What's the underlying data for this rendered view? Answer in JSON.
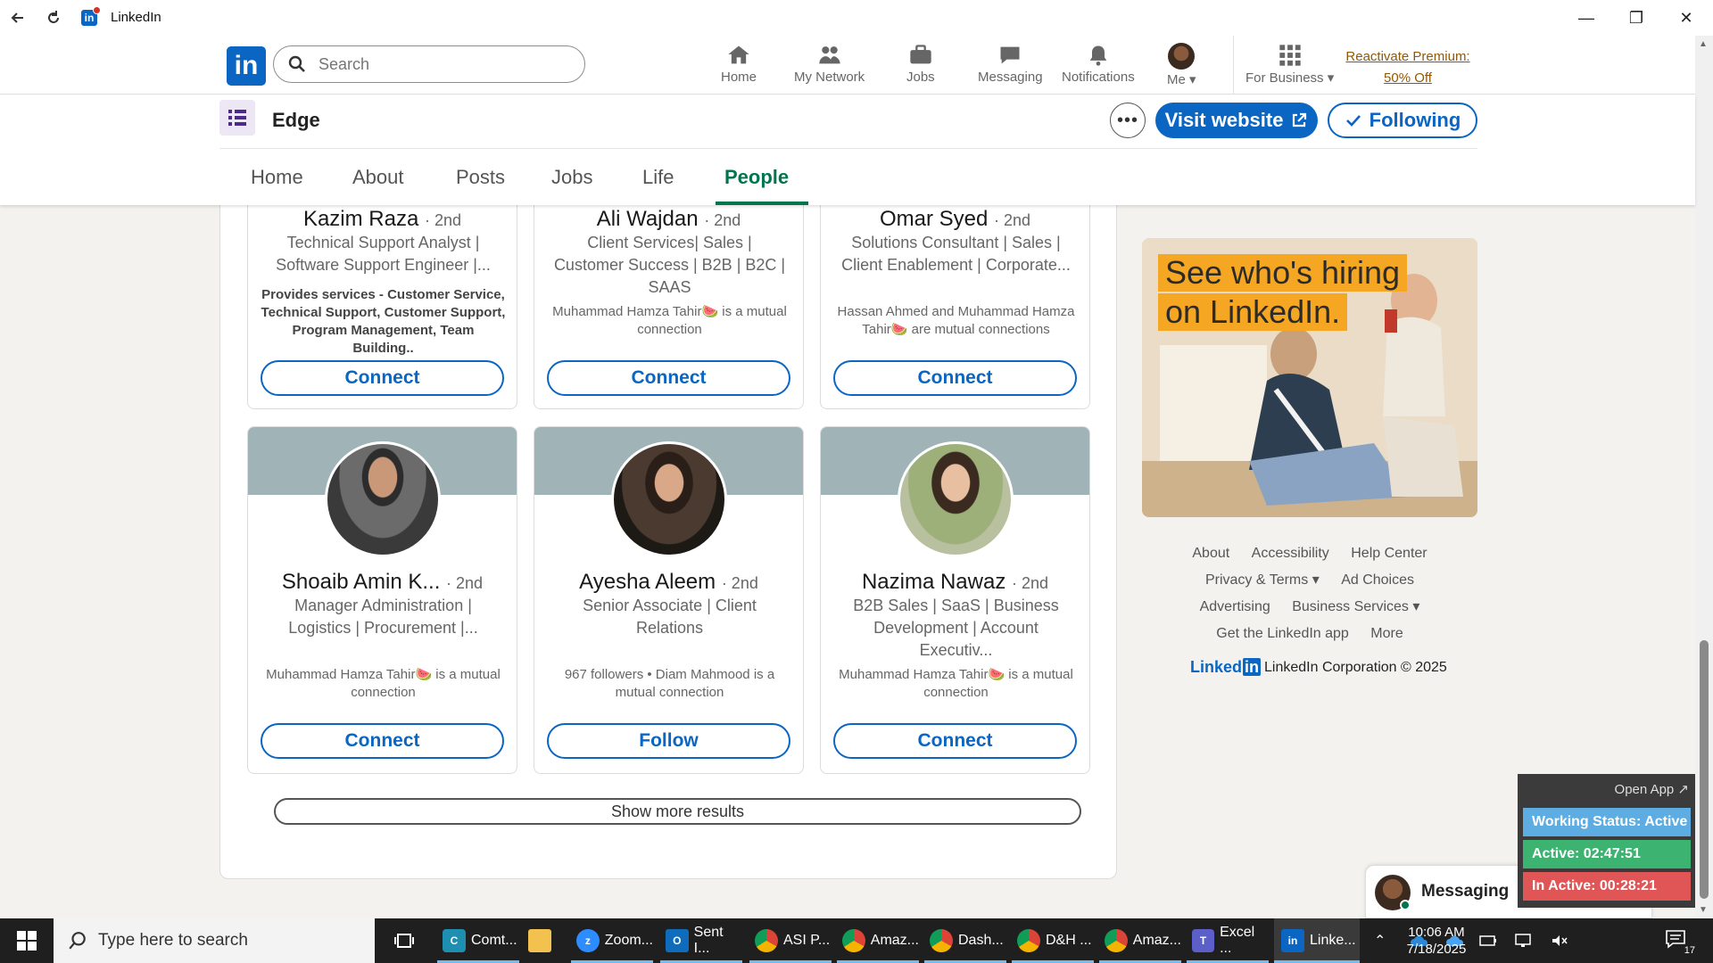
{
  "window": {
    "title": "LinkedIn"
  },
  "nav": {
    "search_placeholder": "Search",
    "items": [
      {
        "label": "Home"
      },
      {
        "label": "My Network"
      },
      {
        "label": "Jobs"
      },
      {
        "label": "Messaging"
      },
      {
        "label": "Notifications"
      },
      {
        "label": "Me"
      },
      {
        "label": "For Business"
      }
    ],
    "premium_line1": "Reactivate Premium:",
    "premium_line2": "50% Off"
  },
  "company": {
    "name": "Edge",
    "more": "•••",
    "visit_label": "Visit website",
    "following_label": "Following",
    "tabs": [
      {
        "label": "Home"
      },
      {
        "label": "About"
      },
      {
        "label": "Posts"
      },
      {
        "label": "Jobs"
      },
      {
        "label": "Life"
      },
      {
        "label": "People"
      }
    ]
  },
  "people_top": [
    {
      "name": "Kazim Raza",
      "degree": "· 2nd",
      "title": "Technical Support Analyst | Software Support Engineer |...",
      "extra": "Provides services - Customer Service, Technical Support, Customer Support, Program Management, Team Building..",
      "action": "Connect"
    },
    {
      "name": "Ali Wajdan",
      "degree": "· 2nd",
      "title": "Client Services| Sales | Customer Success | B2B | B2C | SAAS",
      "mutual": "Muhammad Hamza Tahir🍉 is a mutual connection",
      "action": "Connect"
    },
    {
      "name": "Omar Syed",
      "degree": "· 2nd",
      "title": "Solutions Consultant | Sales | Client Enablement | Corporate...",
      "mutual": "Hassan Ahmed and Muhammad Hamza Tahir🍉 are mutual connections",
      "action": "Connect"
    }
  ],
  "people_bottom": [
    {
      "name": "Shoaib Amin K...",
      "degree": "· 2nd",
      "title": "Manager Administration | Logistics | Procurement |...",
      "mutual": "Muhammad Hamza Tahir🍉 is a mutual connection",
      "action": "Connect"
    },
    {
      "name": "Ayesha Aleem",
      "degree": "· 2nd",
      "title": "Senior Associate | Client Relations",
      "mutual": "967 followers • Diam Mahmood is a mutual connection",
      "action": "Follow"
    },
    {
      "name": "Nazima Nawaz",
      "degree": "· 2nd",
      "title": "B2B Sales | SaaS | Business Development | Account Executiv...",
      "mutual": "Muhammad Hamza Tahir🍉 is a mutual connection",
      "action": "Connect"
    }
  ],
  "show_more": "Show more results",
  "ad": {
    "line1": "See who's hiring",
    "line2": "on LinkedIn."
  },
  "footer": {
    "about": "About",
    "accessibility": "Accessibility",
    "help": "Help Center",
    "privacy": "Privacy & Terms ▾",
    "adchoices": "Ad Choices",
    "advertising": "Advertising",
    "business": "Business Services ▾",
    "getapp": "Get the LinkedIn app",
    "more": "More",
    "brand": "Linked",
    "brand_in": "in",
    "corp": "LinkedIn Corporation © 2025"
  },
  "messaging": {
    "label": "Messaging"
  },
  "status_widget": {
    "open_app": "Open App ↗",
    "working": "Working Status: Active",
    "active": "Active: 02:47:51",
    "inactive": "In Active: 00:28:21"
  },
  "taskbar": {
    "search_placeholder": "Type here to search",
    "apps": [
      {
        "label": "Comt..."
      },
      {
        "label": ""
      },
      {
        "label": "Zoom..."
      },
      {
        "label": "Sent I..."
      },
      {
        "label": "ASI P..."
      },
      {
        "label": "Amaz..."
      },
      {
        "label": "Dash..."
      },
      {
        "label": "D&H ..."
      },
      {
        "label": "Amaz..."
      },
      {
        "label": "Excel ..."
      },
      {
        "label": "Linke..."
      }
    ],
    "time": "10:06 AM",
    "date": "7/18/2025",
    "notif_count": "17"
  },
  "colors": {
    "linkedin_blue": "#0a66c2",
    "active_tab_green": "#01754f",
    "premium_gold": "#915907",
    "status_blue": "#5dade2",
    "status_green": "#3cb371",
    "status_red": "#e05555"
  }
}
